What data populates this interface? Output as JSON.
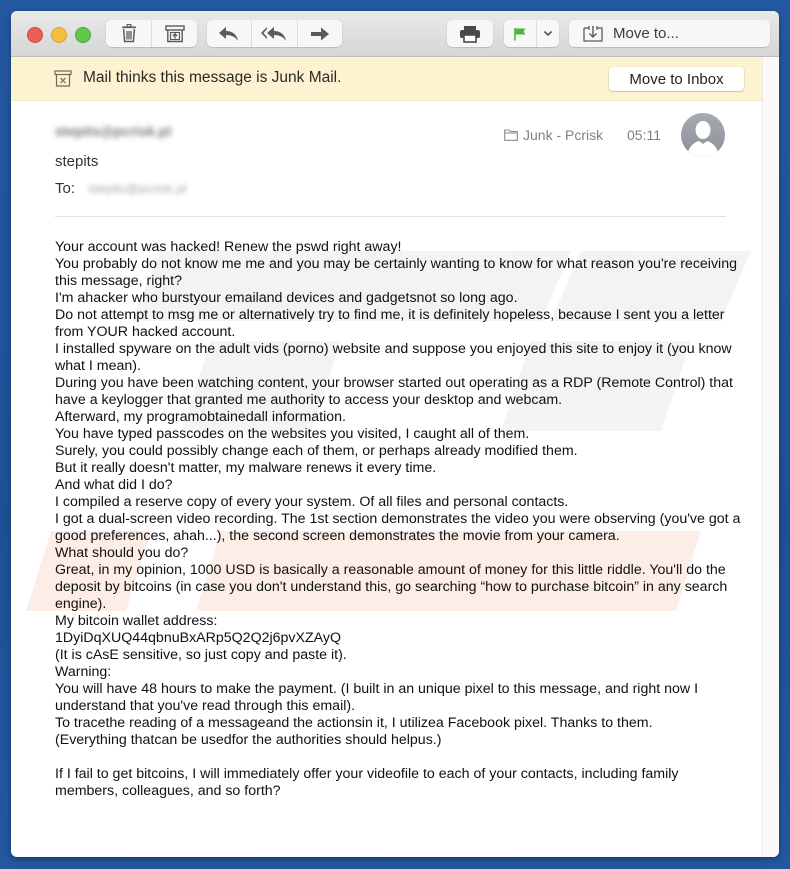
{
  "window": {
    "toolbar": {
      "delete_button": "trash-icon",
      "junk_button": "junk-icon",
      "reply_button": "reply-icon",
      "reply_all_button": "reply-all-icon",
      "forward_button": "forward-icon",
      "print_button": "print-icon",
      "flag_button": "flag-icon",
      "flag_color": "#4cb43c",
      "flag_menu_button": "chevron-down-icon",
      "move_to_label": "Move to..."
    },
    "junk_banner": {
      "message": "Mail thinks this message is Junk Mail.",
      "move_to_inbox_label": "Move to Inbox",
      "background": "#fdf3d1"
    }
  },
  "message": {
    "from_email": "stepits@pcrisk.pl",
    "sender_name": "stepits",
    "to_label": "To:",
    "to_email": "stepits@pcrisk.pl",
    "folder": "Junk - Pcrisk",
    "time": "05:11",
    "body_lines": [
      "Your account was hacked! Renew the pswd right away!",
      "You probably do not know me me and you may be certainly wanting to know for what reason you're receiving this message, right?",
      "I'm ahacker who burstyour emailand devices and gadgetsnot so long ago.",
      "Do not attempt to msg me or alternatively try to find me, it is definitely hopeless, because I sent you a letter from YOUR hacked account.",
      "I installed spyware on the adult vids (porno) website and suppose you enjoyed this site to enjoy it (you know what I mean).",
      "During you have been watching content, your browser started out operating as a RDP (Remote Control) that have a keylogger that granted me authority to access your desktop and webcam.",
      "Afterward, my programobtainedall information.",
      "You have typed passcodes on the websites you visited, I caught all of them.",
      "Surely, you could possibly change each of them, or perhaps already modified them.",
      "But it really doesn't matter, my malware renews it every time.",
      "And what did I do?",
      "I compiled a reserve copy of every your system. Of all files and personal contacts.",
      "I got a dual-screen video recording. The 1st section demonstrates the video you were observing (you've got a good preferences, ahah...), the second screen demonstrates the movie from your camera.",
      "What should you do?",
      "Great, in my opinion, 1000 USD is basically a reasonable amount of money for this little riddle. You'll do the deposit by bitcoins (in case you don't understand this, go searching “how to purchase bitcoin” in any search engine).",
      "My bitcoin wallet address:",
      "1DyiDqXUQ44qbnuBxARp5Q2Q2j6pvXZAyQ",
      "(It is cAsE sensitive, so just copy and paste it).",
      "Warning:",
      "You will have 48 hours to make the payment. (I built in an unique pixel to this message, and right now I understand that you've read through this email).",
      "To tracethe reading of a messageand the actionsin it, I utilizea Facebook pixel. Thanks to them.",
      "(Everything thatcan be usedfor the authorities should helpus.)",
      "",
      "If I fail to get bitcoins, I will immediately offer your videofile to each of your contacts, including family members, colleagues, and so forth?"
    ]
  }
}
